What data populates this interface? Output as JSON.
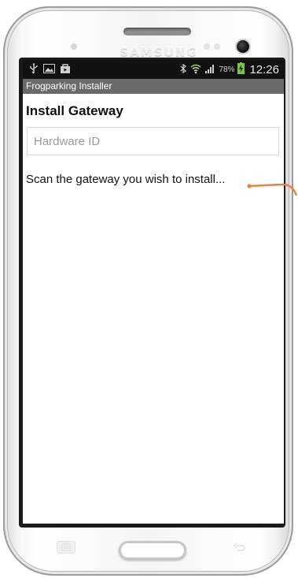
{
  "device": {
    "brand": "SAMSUNG"
  },
  "status_bar": {
    "icons_left": [
      "usb-icon",
      "image-icon",
      "store-icon"
    ],
    "icons_right": [
      "bluetooth-icon",
      "wifi-icon",
      "signal-icon",
      "battery-charging-icon"
    ],
    "battery_percent": "78%",
    "time": "12:26"
  },
  "app": {
    "title": "Frogparking Installer",
    "heading": "Install Gateway",
    "hardware_id": {
      "value": "",
      "placeholder": "Hardware ID"
    },
    "instruction": "Scan the gateway you wish to install..."
  },
  "colors": {
    "status_bar_bg": "#111111",
    "title_bar_bg": "#6a6a6a",
    "callout_line": "#e8823a",
    "battery_charge": "#7dc242"
  }
}
